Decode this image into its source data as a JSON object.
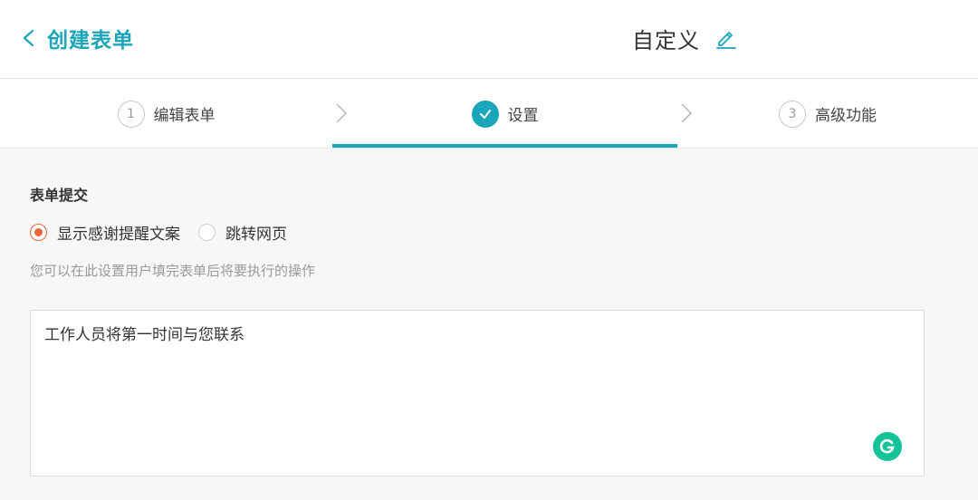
{
  "header": {
    "back_label": "创建表单",
    "title": "自定义"
  },
  "steps": [
    {
      "number": "1",
      "label": "编辑表单",
      "state": "pending"
    },
    {
      "number": "",
      "label": "设置",
      "state": "active"
    },
    {
      "number": "3",
      "label": "高级功能",
      "state": "pending"
    }
  ],
  "form_submit": {
    "title": "表单提交",
    "options": [
      {
        "label": "显示感谢提醒文案",
        "checked": true
      },
      {
        "label": "跳转网页",
        "checked": false
      }
    ],
    "hint": "您可以在此设置用户填完表单后将要执行的操作",
    "message": "工作人员将第一时间与您联系"
  },
  "colors": {
    "accent": "#1aa5b8",
    "radio_checked": "#e8663d",
    "grammarly": "#15c39a"
  },
  "icons": {
    "back": "chevron-left-icon",
    "edit": "pencil-icon",
    "step_separator": "chevron-right-icon",
    "step_done": "check-icon",
    "assistant": "grammarly-icon"
  }
}
